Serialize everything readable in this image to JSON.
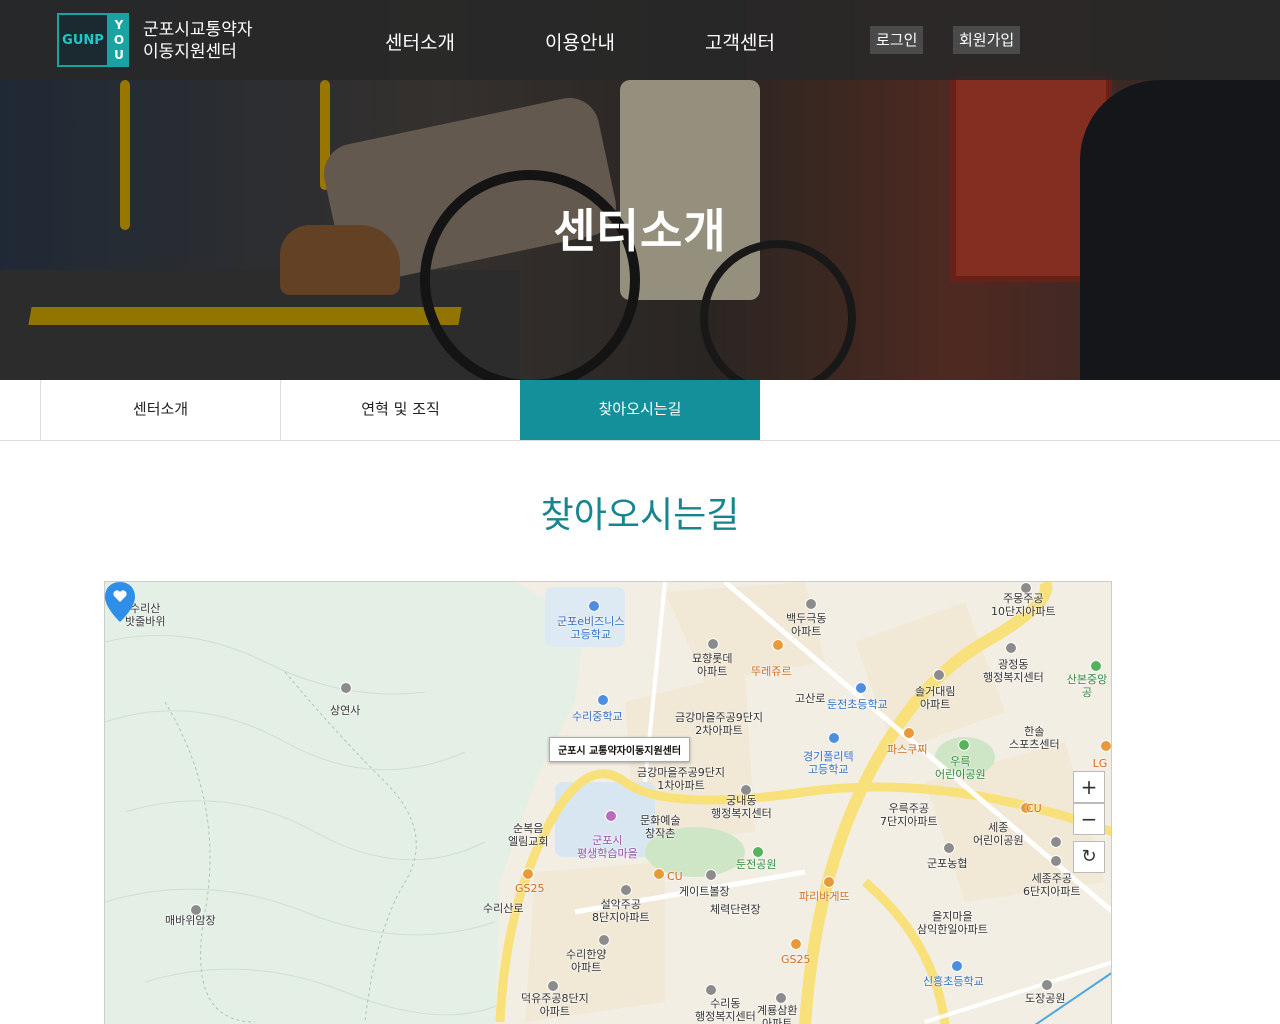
{
  "header": {
    "logo_left": "GUNP",
    "logo_right": [
      "Y",
      "O",
      "U"
    ],
    "org_line1": "군포시교통약자",
    "org_line2": "이동지원센터",
    "nav": [
      "센터소개",
      "이용안내",
      "고객센터"
    ],
    "login": "로그인",
    "signup": "회원가입"
  },
  "hero": {
    "title": "센터소개"
  },
  "tabs": [
    {
      "label": "센터소개",
      "active": false
    },
    {
      "label": "연혁 및 조직",
      "active": false
    },
    {
      "label": "찾아오시는길",
      "active": true
    }
  ],
  "section_title": "찾아오시는길",
  "map": {
    "marker_label": "군포시 교통약자이동지원센터",
    "zoom_in": "+",
    "zoom_out": "−",
    "reset": "↻",
    "labels": [
      {
        "text": "수리산\n밧줄바위",
        "color": "dark"
      },
      {
        "text": "상연사",
        "color": "dark"
      },
      {
        "text": "매바위암장",
        "color": "dark"
      },
      {
        "text": "군포e비즈니스\n고등학교",
        "color": "blue"
      },
      {
        "text": "수리중학교",
        "color": "blue"
      },
      {
        "text": "순복음\n엘림교회",
        "color": "dark"
      },
      {
        "text": "군포시\n평생학습마을",
        "color": "purple"
      },
      {
        "text": "문화예술\n창작촌",
        "color": "dark"
      },
      {
        "text": "GS25",
        "color": "orange"
      },
      {
        "text": "CU",
        "color": "orange"
      },
      {
        "text": "게이트볼장",
        "color": "dark"
      },
      {
        "text": "체력단련장",
        "color": "dark"
      },
      {
        "text": "설악주공\n8단지아파트",
        "color": "dark"
      },
      {
        "text": "수리한양\n아파트",
        "color": "dark"
      },
      {
        "text": "덕유주공8단지\n아파트",
        "color": "dark"
      },
      {
        "text": "수리동\n행정복지센터",
        "color": "dark"
      },
      {
        "text": "묘향롯데\n아파트",
        "color": "dark"
      },
      {
        "text": "뚜레쥬르",
        "color": "orange"
      },
      {
        "text": "백두극동\n아파트",
        "color": "dark"
      },
      {
        "text": "금강마을주공9단지\n2차아파트",
        "color": "dark"
      },
      {
        "text": "금강마을주공9단지\n1차아파트",
        "color": "dark"
      },
      {
        "text": "궁내동\n행정복지센터",
        "color": "dark"
      },
      {
        "text": "둔전공원",
        "color": "green"
      },
      {
        "text": "GS25",
        "color": "orange"
      },
      {
        "text": "계룡삼환\n아파트",
        "color": "dark"
      },
      {
        "text": "파리바게뜨",
        "color": "orange"
      },
      {
        "text": "둔전초등학교",
        "color": "blue"
      },
      {
        "text": "경기폴리텍\n고등학교",
        "color": "blue"
      },
      {
        "text": "솔거대림\n아파트",
        "color": "dark"
      },
      {
        "text": "파스쿠찌",
        "color": "orange"
      },
      {
        "text": "우륵\n어린이공원",
        "color": "green"
      },
      {
        "text": "우륵주공\n7단지아파트",
        "color": "dark"
      },
      {
        "text": "군포농협",
        "color": "dark"
      },
      {
        "text": "을지마을\n삼익한일아파트",
        "color": "dark"
      },
      {
        "text": "신흥초등학교",
        "color": "blue"
      },
      {
        "text": "주몽주공\n10단지아파트",
        "color": "dark"
      },
      {
        "text": "광정동\n행정복지센터",
        "color": "dark"
      },
      {
        "text": "산본중앙공",
        "color": "green"
      },
      {
        "text": "한솔\n스포츠센터",
        "color": "dark"
      },
      {
        "text": "CU",
        "color": "orange"
      },
      {
        "text": "세종\n어린이공원",
        "color": "dark"
      },
      {
        "text": "세종주공\n6단지아파트",
        "color": "dark"
      },
      {
        "text": "도장공원",
        "color": "dark"
      },
      {
        "text": "LG전\n자",
        "color": "orange"
      },
      {
        "text": "고산로",
        "color": "dark"
      },
      {
        "text": "수리산로",
        "color": "dark"
      }
    ]
  }
}
